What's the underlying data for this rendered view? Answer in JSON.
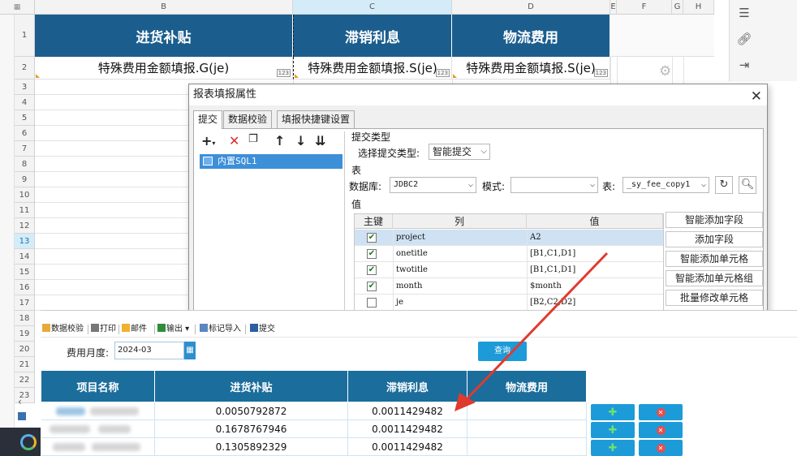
{
  "sheet": {
    "columns": [
      "B",
      "C",
      "D",
      "E",
      "F",
      "G",
      "H"
    ],
    "rows": [
      "1",
      "2",
      "3",
      "4",
      "5",
      "6",
      "7",
      "8",
      "9",
      "10",
      "11",
      "12",
      "13",
      "14",
      "15",
      "16",
      "17",
      "18",
      "19",
      "20",
      "21",
      "22",
      "23"
    ],
    "header_cells": [
      "进货补贴",
      "滞销利息",
      "物流费用"
    ],
    "formula_cells": [
      "特殊费用金额填报.G(je)",
      "特殊费用金额填报.S(je)",
      "特殊费用金额填报.S(je)"
    ],
    "badge": "123"
  },
  "dialog": {
    "title": "报表填报属性",
    "tabs": [
      "提交",
      "数据校验",
      "填报快捷键设置"
    ],
    "sql_item": "内置SQL1",
    "section_submit_type": "提交类型",
    "select_type_label": "选择提交类型:",
    "submit_type_value": "智能提交",
    "section_table": "表",
    "database_label": "数据库:",
    "database_value": "JDBC2",
    "schema_label": "模式:",
    "schema_value": "",
    "table_label": "表:",
    "table_value": "_sy_fee_copy1",
    "section_value": "值",
    "value_table": {
      "headers": [
        "主键",
        "列",
        "值"
      ],
      "rows": [
        {
          "checked": true,
          "column": "project",
          "value": "A2"
        },
        {
          "checked": true,
          "column": "onetitle",
          "value": "[B1,C1,D1]"
        },
        {
          "checked": true,
          "column": "twotitle",
          "value": "[B1,C1,D1]"
        },
        {
          "checked": true,
          "column": "month",
          "value": "$month"
        },
        {
          "checked": false,
          "column": "je",
          "value": "[B2,C2,D2]"
        }
      ]
    },
    "side_buttons": [
      "智能添加字段",
      "添加字段",
      "智能添加单元格",
      "智能添加单元格组",
      "批量修改单元格"
    ]
  },
  "preview": {
    "toolbar": [
      "数据校验",
      "打印",
      "邮件",
      "输出",
      "标记导入",
      "提交"
    ],
    "month_label": "费用月度:",
    "month_value": "2024-03",
    "query_label": "查询",
    "table_headers": [
      "项目名称",
      "进货补贴",
      "滞销利息",
      "物流费用"
    ],
    "rows": [
      {
        "subsidy": "0.0050792872",
        "interest": "0.0011429482",
        "logistics": ""
      },
      {
        "subsidy": "0.1678767946",
        "interest": "0.0011429482",
        "logistics": ""
      },
      {
        "subsidy": "0.1305892329",
        "interest": "0.0011429482",
        "logistics": ""
      }
    ],
    "add_icon": "plus-icon",
    "delete_icon": "close-circle-icon"
  },
  "colors": {
    "header_blue": "#1b5e8e",
    "preview_header_blue": "#1b6d9c",
    "selection_blue": "#3d8fd8",
    "arrow_red": "#e03a2f"
  }
}
